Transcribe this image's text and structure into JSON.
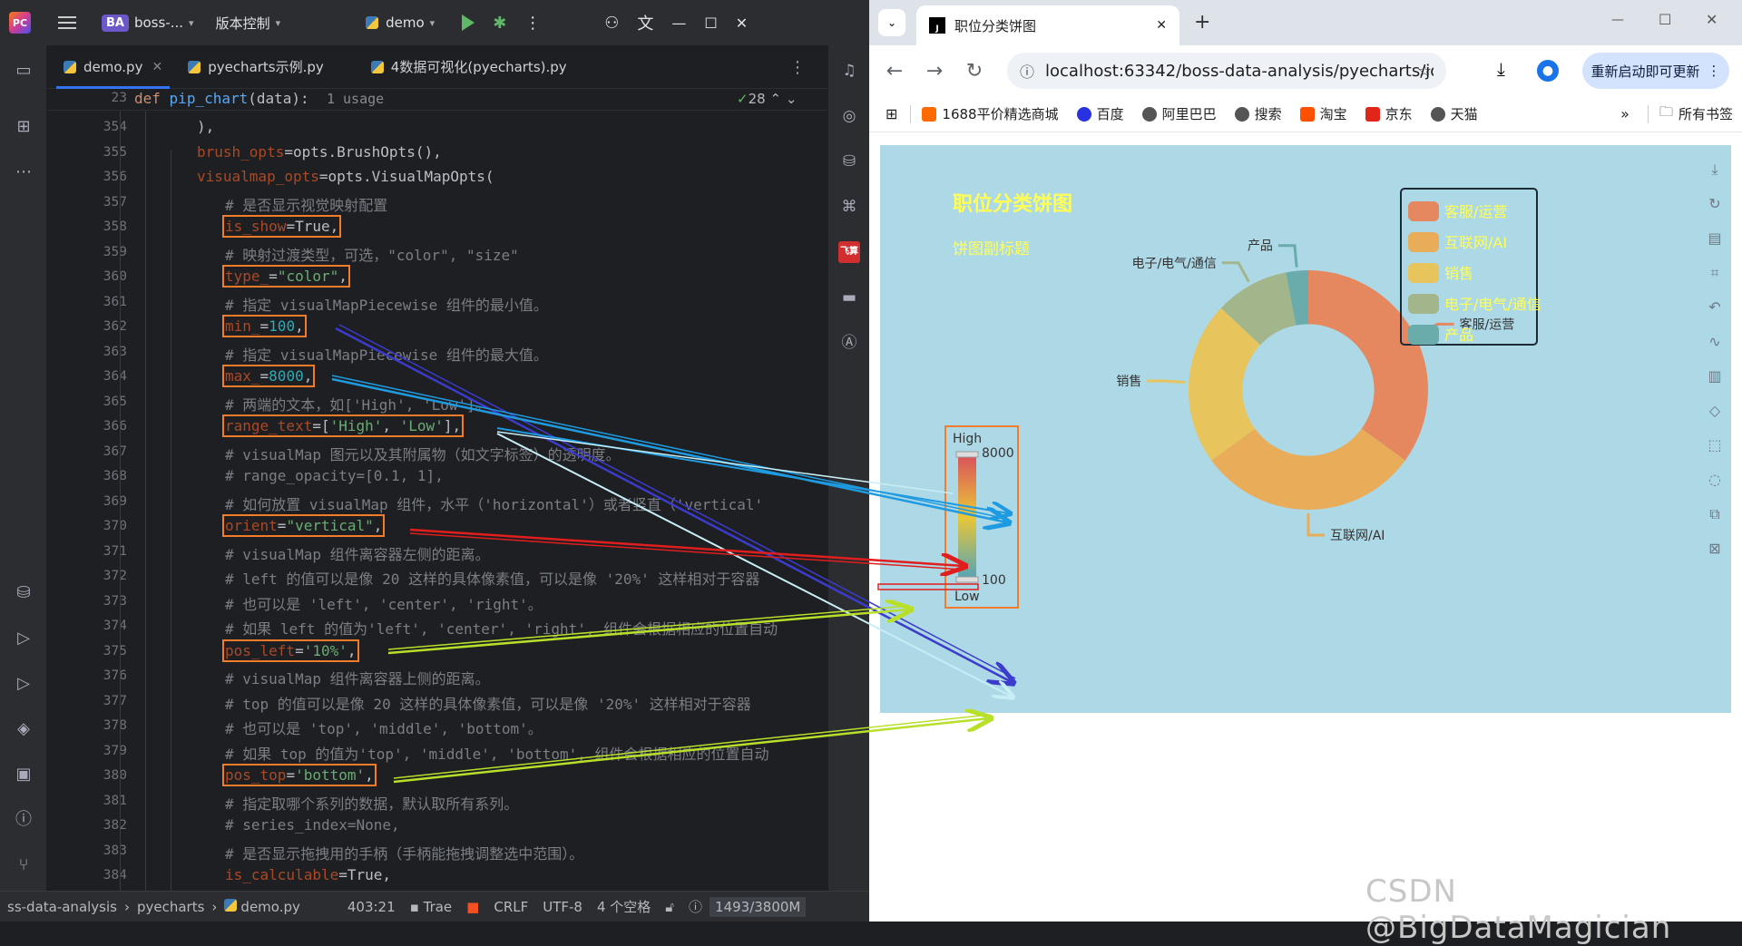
{
  "ide": {
    "project_badge": "BA",
    "project_name": "boss-...",
    "vcs_menu": "版本控制",
    "run_config": "demo",
    "tabs": [
      {
        "label": "demo.py",
        "active": true
      },
      {
        "label": "pyecharts示例.py"
      },
      {
        "label": "4数据可视化(pyecharts).py"
      }
    ],
    "sticky_line": {
      "num": "23",
      "kw": "def",
      "fn": "pip_chart",
      "rest": "(data):",
      "usage": "1 usage"
    },
    "inspection_count": "28",
    "line_numbers": [
      "354",
      "355",
      "356",
      "357",
      "358",
      "359",
      "360",
      "361",
      "362",
      "363",
      "364",
      "365",
      "366",
      "367",
      "368",
      "369",
      "370",
      "371",
      "372",
      "373",
      "374",
      "375",
      "376",
      "377",
      "378",
      "379",
      "380",
      "381",
      "382",
      "383",
      "384"
    ],
    "code": {
      "l354": "),",
      "l355_p": "brush_opts",
      "l355_r": "=opts.BrushOpts(),",
      "l356_p": "visualmap_opts",
      "l356_r": "=opts.VisualMapOpts(",
      "l357": "# 是否显示视觉映射配置",
      "l358_p": "is_show",
      "l358_r": "=True,",
      "l359": "# 映射过渡类型，可选，\"color\", \"size\"",
      "l360_p": "type_",
      "l360_e": "=",
      "l360_s": "\"color\"",
      "l360_c": ",",
      "l361": "# 指定 visualMapPiecewise 组件的最小值。",
      "l362_p": "min_",
      "l362_e": "=",
      "l362_n": "100",
      "l362_c": ",",
      "l363": "# 指定 visualMapPiecewise 组件的最大值。",
      "l364_p": "max_",
      "l364_e": "=",
      "l364_n": "8000",
      "l364_c": ",",
      "l365": "# 两端的文本，如['High', 'Low']。",
      "l366_p": "range_text",
      "l366_e": "=[",
      "l366_s1": "'High'",
      "l366_m": ", ",
      "l366_s2": "'Low'",
      "l366_c": "],",
      "l367": "# visualMap 图元以及其附属物（如文字标签）的透明度。",
      "l368": "# range_opacity=[0.1, 1],",
      "l369": "# 如何放置 visualMap 组件，水平（'horizontal'）或者竖直（'vertical'",
      "l370_p": "orient",
      "l370_e": "=",
      "l370_s": "\"vertical\"",
      "l370_c": ",",
      "l371": "# visualMap 组件离容器左侧的距离。",
      "l372": "# left 的值可以是像 20 这样的具体像素值，可以是像 '20%' 这样相对于容器",
      "l373": "# 也可以是 'left', 'center', 'right'。",
      "l374": "# 如果 left 的值为'left', 'center', 'right', 组件会根据相应的位置自动",
      "l375_p": "pos_left",
      "l375_e": "=",
      "l375_s": "'10%'",
      "l375_c": ",",
      "l376": "# visualMap 组件离容器上侧的距离。",
      "l377": "# top 的值可以是像 20 这样的具体像素值，可以是像 '20%' 这样相对于容器",
      "l378": "# 也可以是 'top', 'middle', 'bottom'。",
      "l379": "# 如果 top 的值为'top', 'middle', 'bottom', 组件会根据相应的位置自动",
      "l380_p": "pos_top",
      "l380_e": "=",
      "l380_s": "'bottom'",
      "l380_c": ",",
      "l381": "# 指定取哪个系列的数据，默认取所有系列。",
      "l382": "# series_index=None,",
      "l383": "# 是否显示拖拽用的手柄（手柄能拖拽调整选中范围）。",
      "l384_p": "is_calculable",
      "l384_r": "=True,"
    },
    "status": {
      "path_project": "ss-data-analysis",
      "path_dir": "pyecharts",
      "path_file": "demo.py",
      "position": "403:21",
      "trae": "Trae",
      "line_sep": "CRLF",
      "encoding": "UTF-8",
      "indent": "4 个空格",
      "memory": "1493/3800M"
    }
  },
  "browser": {
    "tab_title": "职位分类饼图",
    "url": "localhost:63342/boss-data-analysis/pyecharts/jo...",
    "update_button": "重新启动即可更新",
    "bookmarks": [
      "1688平价精选商城",
      "百度",
      "阿里巴巴",
      "搜索",
      "淘宝",
      "京东",
      "天猫"
    ],
    "all_bookmarks": "所有书签",
    "watermark": "CSDN @BigDataMagician"
  },
  "colors": {
    "chart_bg": "#add8e6",
    "title": "#ffff55",
    "highlight_box": "#f27c2a",
    "arrow_blue": "#1e9be0",
    "arrow_indigo": "#3b3bcc",
    "arrow_red": "#e01e1e",
    "arrow_lime": "#b8e02a",
    "arrow_pale": "#c8eef5"
  },
  "chart_data": {
    "type": "pie",
    "title": "职位分类饼图",
    "subtitle": "饼图副标题",
    "legend_position": "top-right",
    "inner_radius_ratio": 0.55,
    "series": [
      {
        "name": "客服/运营",
        "value": 35,
        "color": "#e5875f"
      },
      {
        "name": "互联网/AI",
        "value": 30,
        "color": "#e9ad5a"
      },
      {
        "name": "销售",
        "value": 22,
        "color": "#e8c45c"
      },
      {
        "name": "电子/电气/通信",
        "value": 10,
        "color": "#a3b58a"
      },
      {
        "name": "产品",
        "value": 3,
        "color": "#6aabab"
      }
    ],
    "visual_map": {
      "min": 100,
      "max": 8000,
      "text_high": "High",
      "text_low": "Low",
      "orient": "vertical",
      "max_label": "8000",
      "min_label": "100"
    }
  }
}
